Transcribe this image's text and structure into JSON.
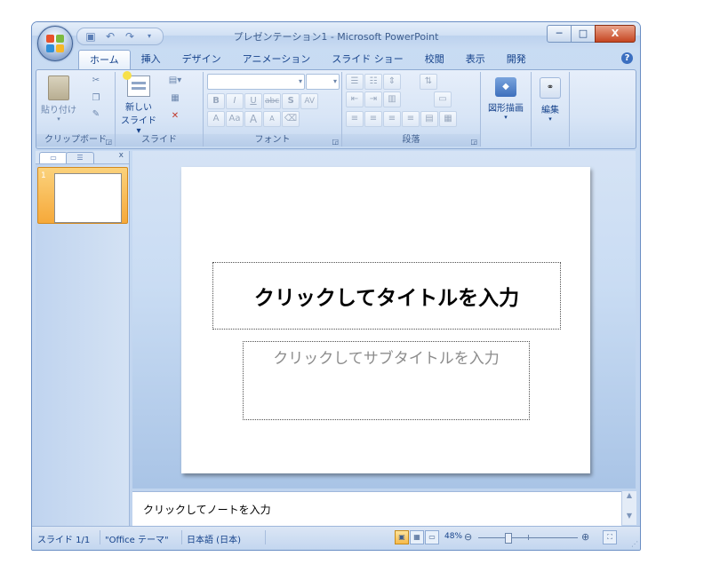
{
  "app": {
    "title": "プレゼンテーション1 - Microsoft PowerPoint"
  },
  "quick_access": {
    "save_icon": "save-icon",
    "undo_icon": "undo-icon",
    "redo_icon": "redo-icon"
  },
  "window_controls": {
    "minimize": "─",
    "maximize": "□",
    "close": "X"
  },
  "tabs": [
    "ホーム",
    "挿入",
    "デザイン",
    "アニメーション",
    "スライド ショー",
    "校閲",
    "表示",
    "開発"
  ],
  "ribbon": {
    "clipboard": {
      "label": "クリップボード",
      "paste": "貼り付け"
    },
    "slides": {
      "label": "スライド",
      "new_slide_line1": "新しい",
      "new_slide_line2": "スライド ▾"
    },
    "font": {
      "label": "フォント",
      "bold": "B",
      "italic": "I",
      "underline": "U",
      "strike": "abc",
      "shadow": "S",
      "spacing": "AV",
      "color": "A",
      "case": "Aa",
      "grow": "A",
      "shrink": "A"
    },
    "paragraph": {
      "label": "段落"
    },
    "drawing": {
      "label": "図形描画"
    },
    "editing": {
      "label": "編集"
    }
  },
  "slide_pane": {
    "slide_number": "1"
  },
  "slide": {
    "title_placeholder": "クリックしてタイトルを入力",
    "subtitle_placeholder": "クリックしてサブタイトルを入力"
  },
  "notes": {
    "placeholder": "クリックしてノートを入力"
  },
  "status_bar": {
    "slide_info": "スライド 1/1",
    "theme": "\"Office テーマ\"",
    "language": "日本語 (日本)",
    "zoom": "48%"
  }
}
